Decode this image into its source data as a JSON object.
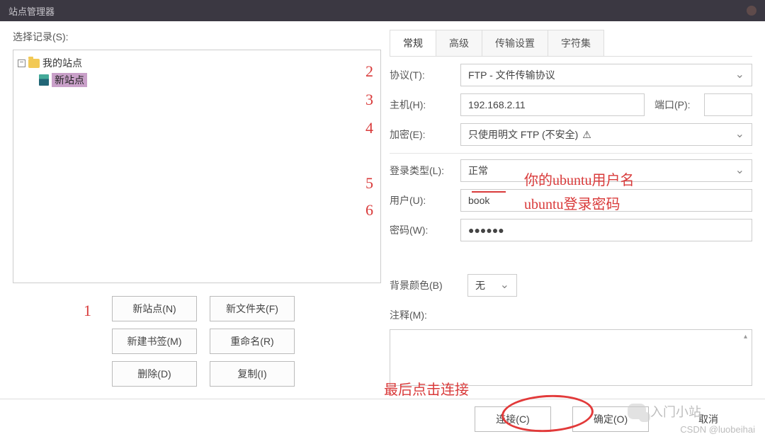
{
  "title": "站点管理器",
  "left": {
    "selectLabel": "选择记录(S):",
    "treeRoot": "我的站点",
    "treeChild": "新站点",
    "buttons": {
      "newSite": "新站点(N)",
      "newFolder": "新文件夹(F)",
      "newBookmark": "新建书签(M)",
      "rename": "重命名(R)",
      "delete": "删除(D)",
      "copy": "复制(I)"
    }
  },
  "tabs": {
    "general": "常规",
    "advanced": "高级",
    "transfer": "传输设置",
    "charset": "字符集"
  },
  "form": {
    "protocolLabel": "协议(T):",
    "protocolValue": "FTP - 文件传输协议",
    "hostLabel": "主机(H):",
    "hostValue": "192.168.2.11",
    "portLabel": "端口(P):",
    "portValue": "",
    "encLabel": "加密(E):",
    "encValue": "只使用明文 FTP (不安全)",
    "encWarn": "⚠",
    "loginTypeLabel": "登录类型(L):",
    "loginTypeValue": "正常",
    "userLabel": "用户(U):",
    "userValue": "book",
    "passLabel": "密码(W):",
    "passValue": "●●●●●●",
    "bgLabel": "背景颜色(B)",
    "bgValue": "无",
    "commentLabel": "注释(M):"
  },
  "bottom": {
    "connect": "连接(C)",
    "ok": "确定(O)",
    "cancel": "取消"
  },
  "annot": {
    "n1": "1",
    "n2": "2",
    "n3": "3",
    "n4": "4",
    "n5": "5",
    "n6": "6",
    "userHint": "你的ubuntu用户名",
    "passHint": "ubuntu登录密码",
    "connectHint": "最后点击连接"
  },
  "watermark": "CSDN @luobeihai",
  "wechatText": "入门小站"
}
